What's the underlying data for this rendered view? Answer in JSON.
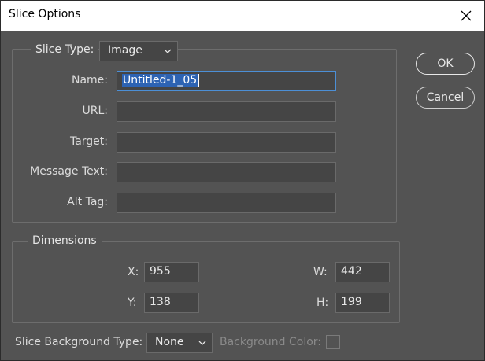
{
  "window": {
    "title": "Slice Options"
  },
  "slice_type": {
    "label": "Slice Type:",
    "value": "Image"
  },
  "fields": {
    "name": {
      "label": "Name:",
      "value": "Untitled-1_05"
    },
    "url": {
      "label": "URL:",
      "value": ""
    },
    "target": {
      "label": "Target:",
      "value": ""
    },
    "message_text": {
      "label": "Message Text:",
      "value": ""
    },
    "alt_tag": {
      "label": "Alt Tag:",
      "value": ""
    }
  },
  "dimensions": {
    "legend": "Dimensions",
    "x": {
      "label": "X:",
      "value": "955"
    },
    "y": {
      "label": "Y:",
      "value": "138"
    },
    "w": {
      "label": "W:",
      "value": "442"
    },
    "h": {
      "label": "H:",
      "value": "199"
    }
  },
  "background": {
    "type_label": "Slice Background Type:",
    "type_value": "None",
    "color_label": "Background Color:"
  },
  "buttons": {
    "ok": "OK",
    "cancel": "Cancel"
  },
  "colors": {
    "dialog_bg": "#535353",
    "field_bg": "#454545",
    "focus_border": "#4c8fd6",
    "selection": "#2d63b3"
  },
  "icons": {
    "close": "close-icon",
    "dropdown": "chevron-down-icon"
  }
}
